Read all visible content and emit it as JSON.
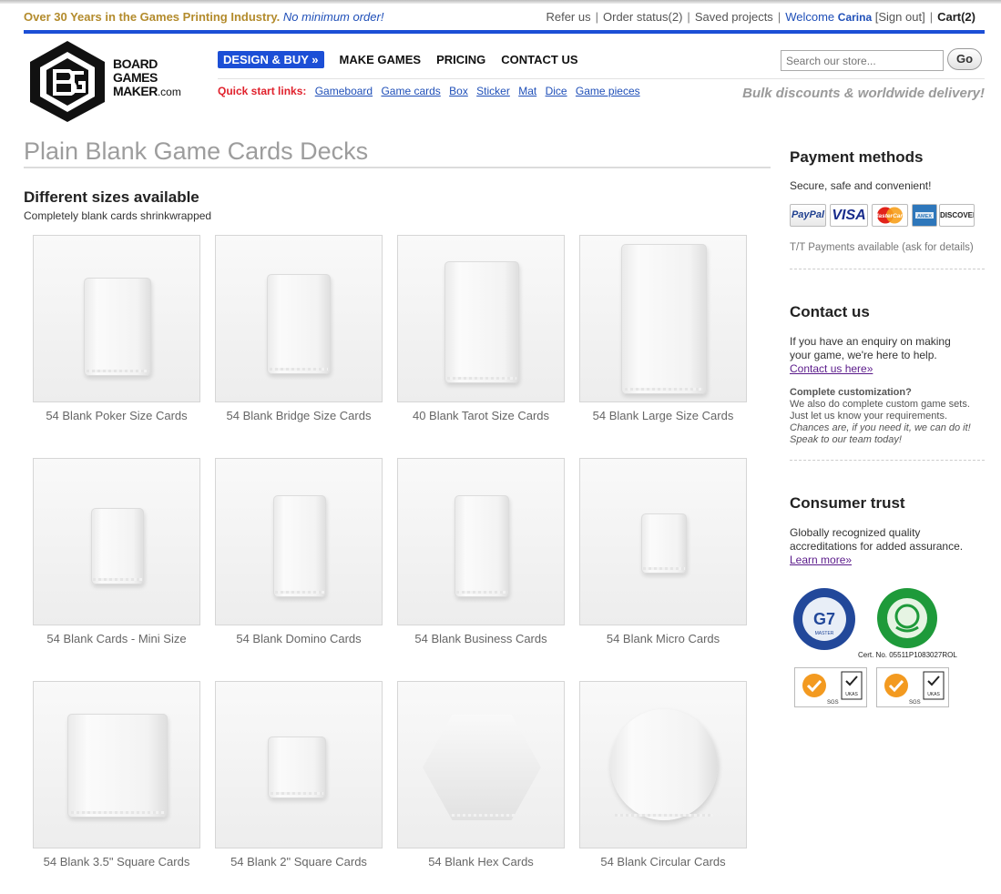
{
  "utility": {
    "promo_strong": "Over 30 Years in the Games Printing Industry.",
    "promo_em": "No minimum order!",
    "refer": "Refer us",
    "order_status": "Order status(2)",
    "saved": "Saved projects",
    "welcome": "Welcome",
    "username": "Carina",
    "signout": "[Sign out]",
    "cart": "Cart(2)"
  },
  "logo": {
    "line1": "BOARD",
    "line2": "GAMES",
    "line3": "MAKER",
    "suffix": ".com"
  },
  "nav": {
    "design_buy": "DESIGN & BUY »",
    "make_games": "MAKE GAMES",
    "pricing": "PRICING",
    "contact": "CONTACT US"
  },
  "search": {
    "placeholder": "Search our store...",
    "button": "Go"
  },
  "quick_links": {
    "label": "Quick start links:",
    "items": [
      "Gameboard",
      "Game cards",
      "Box",
      "Sticker",
      "Mat",
      "Dice",
      "Game pieces"
    ]
  },
  "tagline": "Bulk discounts & worldwide delivery!",
  "main": {
    "title": "Plain Blank Game Cards Decks",
    "section_title": "Different sizes available",
    "section_sub": "Completely blank cards shrinkwrapped",
    "products": [
      "54 Blank Poker Size Cards",
      "54 Blank Bridge Size Cards",
      "40 Blank Tarot Size Cards",
      "54 Blank Large Size Cards",
      "54 Blank Cards - Mini Size",
      "54 Blank Domino Cards",
      "54 Blank Business Cards",
      "54 Blank Micro Cards",
      "54 Blank 3.5\" Square Cards",
      "54 Blank 2\" Square Cards",
      "54 Blank Hex Cards",
      "54 Blank Circular Cards"
    ]
  },
  "sidebar": {
    "payment": {
      "title": "Payment methods",
      "text": "Secure, safe and convenient!",
      "cards": [
        "PayPal",
        "VISA",
        "MasterCard",
        "AMEX",
        "DISCOVER"
      ],
      "note": "T/T Payments available (ask for details)"
    },
    "contact": {
      "title": "Contact us",
      "text": "If you have an enquiry on making your game, we're here to help.",
      "link": "Contact us here»",
      "custom_title": "Complete customization?",
      "custom_text": "We also do complete custom game sets. Just let us know your requirements.",
      "custom_italic": "Chances are, if you need it, we can do it! Speak to our team today!"
    },
    "trust": {
      "title": "Consumer trust",
      "text": "Globally recognized quality accreditations for added assurance.",
      "link": "Learn more»",
      "g7_label": "G7",
      "g7_sub": "MASTER",
      "cert": "Cert. No. 05511P1083027ROL",
      "sgs": "SGS",
      "ukas": "UKAS"
    }
  },
  "colors": {
    "brand_blue": "#1c4fd6",
    "gold": "#b38b2c",
    "quick_red": "#e0212c"
  }
}
